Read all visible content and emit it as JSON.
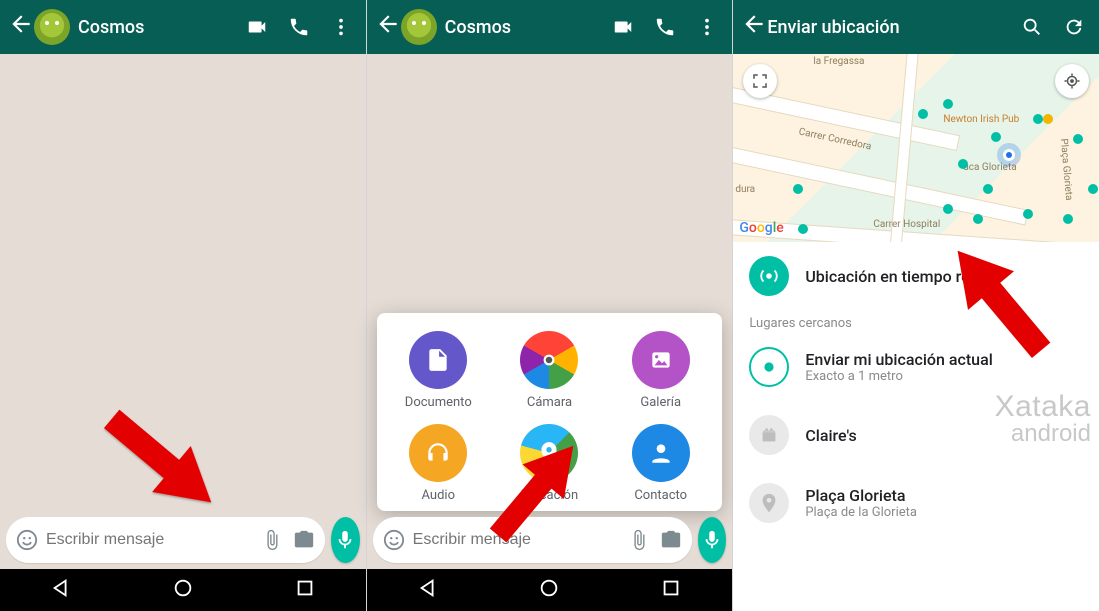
{
  "screen1": {
    "title": "Cosmos",
    "input_placeholder": "Escribir mensaje"
  },
  "screen2": {
    "title": "Cosmos",
    "input_placeholder": "Escribir mensaje",
    "attach": {
      "document": "Documento",
      "camera": "Cámara",
      "gallery": "Galería",
      "audio": "Audio",
      "location": "Ubicación",
      "contact": "Contacto"
    }
  },
  "screen3": {
    "title": "Enviar ubicación",
    "map": {
      "label_fregassa": "la Fregassa",
      "label_corredora": "Carrer Corredora",
      "label_hospital": "Carrer Hospital",
      "label_dura": "dura",
      "poi_newton": "Newton Irish Pub",
      "poi_glorieta": "aca Glorieta",
      "poi_side": "Plaça Glorieta"
    },
    "live_location": "Ubicación en tiempo real",
    "nearby_label": "Lugares cercanos",
    "current_loc_title": "Enviar mi ubicación actual",
    "current_loc_sub": "Exacto a 1 metro",
    "place1": "Claire's",
    "place2_title": "Plaça Glorieta",
    "place2_sub": "Plaça de la Glorieta",
    "watermark_l1": "Xataka",
    "watermark_l2": "android"
  }
}
